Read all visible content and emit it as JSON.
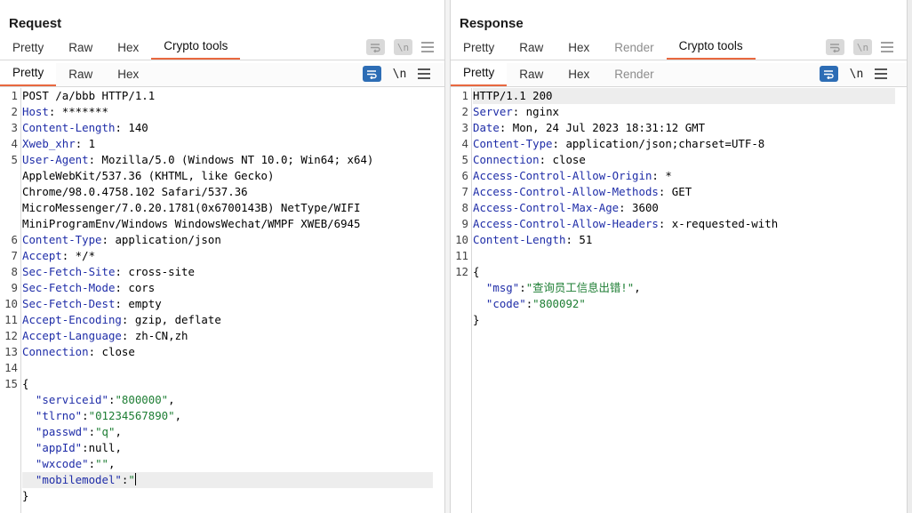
{
  "request": {
    "title": "Request",
    "top_tabs": [
      "Pretty",
      "Raw",
      "Hex",
      "Crypto tools"
    ],
    "sub_tabs": [
      "Pretty",
      "Raw",
      "Hex"
    ],
    "wrap_label": "\\n",
    "lines": [
      {
        "n": "1",
        "t": "POST /a/bbb HTTP/1.1"
      },
      {
        "n": "2",
        "k": "Host",
        "v": ": *******"
      },
      {
        "n": "3",
        "k": "Content-Length",
        "v": ": 140"
      },
      {
        "n": "4",
        "k": "Xweb_xhr",
        "v": ": 1"
      },
      {
        "n": "5",
        "k": "User-Agent",
        "v": ": Mozilla/5.0 (Windows NT 10.0; Win64; x64)"
      },
      {
        "n": "",
        "t": "AppleWebKit/537.36 (KHTML, like Gecko)"
      },
      {
        "n": "",
        "t": "Chrome/98.0.4758.102 Safari/537.36"
      },
      {
        "n": "",
        "t": "MicroMessenger/7.0.20.1781(0x6700143B) NetType/WIFI"
      },
      {
        "n": "",
        "t": "MiniProgramEnv/Windows WindowsWechat/WMPF XWEB/6945"
      },
      {
        "n": "6",
        "k": "Content-Type",
        "v": ": application/json"
      },
      {
        "n": "7",
        "k": "Accept",
        "v": ": */*"
      },
      {
        "n": "8",
        "k": "Sec-Fetch-Site",
        "v": ": cross-site"
      },
      {
        "n": "9",
        "k": "Sec-Fetch-Mode",
        "v": ": cors"
      },
      {
        "n": "10",
        "k": "Sec-Fetch-Dest",
        "v": ": empty"
      },
      {
        "n": "11",
        "k": "Accept-Encoding",
        "v": ": gzip, deflate"
      },
      {
        "n": "12",
        "k": "Accept-Language",
        "v": ": zh-CN,zh"
      },
      {
        "n": "13",
        "k": "Connection",
        "v": ": close"
      },
      {
        "n": "14",
        "t": ""
      },
      {
        "n": "15",
        "t": "{"
      },
      {
        "n": "",
        "k": "  \"serviceid\"",
        "v": ":",
        "s": "\"800000\"",
        "e": ","
      },
      {
        "n": "",
        "k": "  \"tlrno\"",
        "v": ":",
        "s": "\"01234567890\"",
        "e": ","
      },
      {
        "n": "",
        "k": "  \"passwd\"",
        "v": ":",
        "s": "\"q\"",
        "e": ","
      },
      {
        "n": "",
        "k": "  \"appId\"",
        "v": ":null,"
      },
      {
        "n": "",
        "k": "  \"wxcode\"",
        "v": ":",
        "s": "\"\"",
        "e": ","
      },
      {
        "n": "",
        "k": "  \"mobilemodel\"",
        "v": ":",
        "s": "\"",
        "caret": true,
        "hl": true
      },
      {
        "n": "",
        "t": "}"
      }
    ]
  },
  "response": {
    "title": "Response",
    "top_tabs": [
      "Pretty",
      "Raw",
      "Hex",
      "Render",
      "Crypto tools"
    ],
    "sub_tabs": [
      "Pretty",
      "Raw",
      "Hex",
      "Render"
    ],
    "wrap_label": "\\n",
    "lines": [
      {
        "n": "1",
        "t": "HTTP/1.1 200",
        "hl": true
      },
      {
        "n": "2",
        "k": "Server",
        "v": ": nginx"
      },
      {
        "n": "3",
        "k": "Date",
        "v": ": Mon, 24 Jul 2023 18:31:12 GMT"
      },
      {
        "n": "4",
        "k": "Content-Type",
        "v": ": application/json;charset=UTF-8"
      },
      {
        "n": "5",
        "k": "Connection",
        "v": ": close"
      },
      {
        "n": "6",
        "k": "Access-Control-Allow-Origin",
        "v": ": *"
      },
      {
        "n": "7",
        "k": "Access-Control-Allow-Methods",
        "v": ": GET"
      },
      {
        "n": "8",
        "k": "Access-Control-Max-Age",
        "v": ": 3600"
      },
      {
        "n": "9",
        "k": "Access-Control-Allow-Headers",
        "v": ": x-requested-with"
      },
      {
        "n": "10",
        "k": "Content-Length",
        "v": ": 51"
      },
      {
        "n": "11",
        "t": ""
      },
      {
        "n": "12",
        "t": "{"
      },
      {
        "n": "",
        "k": "  \"msg\"",
        "v": ":",
        "s": "\"查询员工信息出错!\"",
        "e": ","
      },
      {
        "n": "",
        "k": "  \"code\"",
        "v": ":",
        "s": "\"800092\""
      },
      {
        "n": "",
        "t": "}"
      }
    ]
  },
  "colors": {
    "accent": "#e8683f",
    "header_key": "#1f2da8",
    "string": "#1e7e34",
    "button_blue": "#2d6db5"
  },
  "icons": [
    "wrap-icon",
    "newline-icon",
    "menu-icon",
    "layout-side-by-side-icon",
    "layout-top-bottom-icon",
    "layout-tabs-icon"
  ]
}
